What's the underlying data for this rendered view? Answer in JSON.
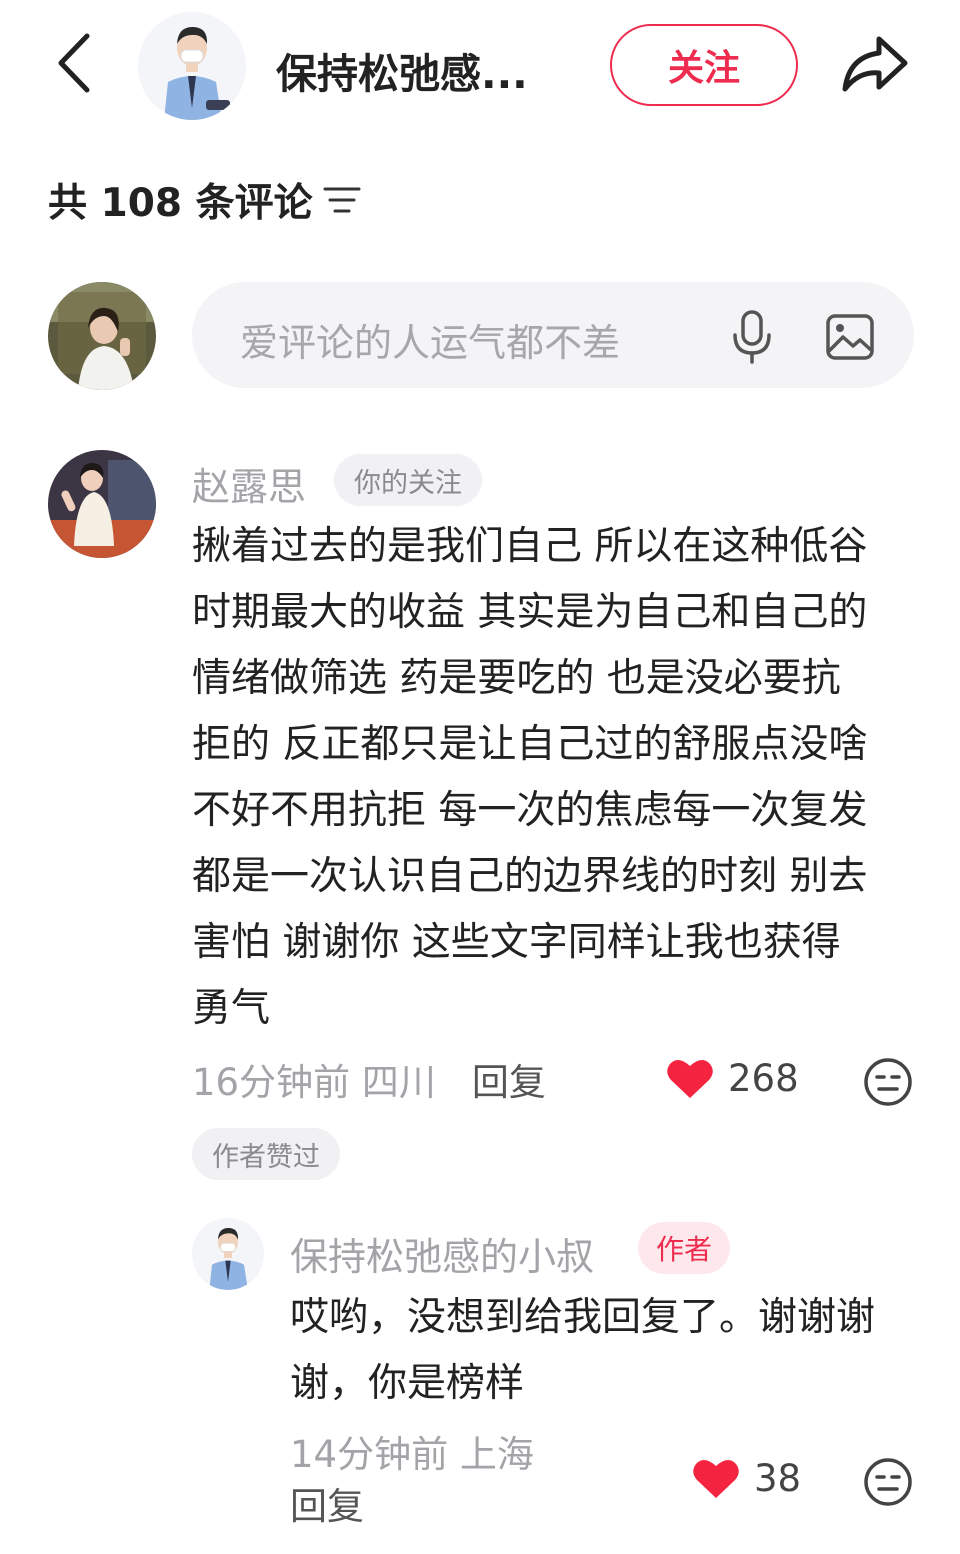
{
  "header": {
    "author_name": "保持松弛感...",
    "follow_label": "关注"
  },
  "comments_summary": {
    "count_text": "共 108 条评论"
  },
  "input": {
    "placeholder": "爱评论的人运气都不差"
  },
  "comment": {
    "user": "赵露思",
    "tag": "你的关注",
    "lines": [
      "揪着过去的是我们自己 所以在这种低谷",
      "时期最大的收益 其实是为自己和自己的",
      "情绪做筛选 药是要吃的 也是没必要抗",
      "拒的 反正都只是让自己过的舒服点没啥",
      "不好不用抗拒 每一次的焦虑每一次复发",
      "都是一次认识自己的边界线的时刻 别去",
      "害怕 谢谢你 这些文字同样让我也获得",
      "勇气"
    ],
    "time_location": "16分钟前 四川",
    "reply_label": "回复",
    "likes": "268",
    "badge": "作者赞过"
  },
  "reply": {
    "user": "保持松弛感的小叔",
    "tag": "作者",
    "lines": [
      "哎哟，没想到给我回复了。谢谢谢",
      "谢，你是榜样"
    ],
    "time_location": "14分钟前 上海",
    "reply_label": "回复",
    "likes": "38"
  },
  "colors": {
    "accent": "#ee2c50",
    "heart": "#f4233f",
    "muted_text": "#a3a3a8",
    "input_bg": "#f4f4f6"
  },
  "icons": [
    "back-arrow-icon",
    "share-arrow-icon",
    "sort-filter-icon",
    "microphone-icon",
    "image-icon",
    "heart-icon",
    "dislike-face-icon"
  ]
}
